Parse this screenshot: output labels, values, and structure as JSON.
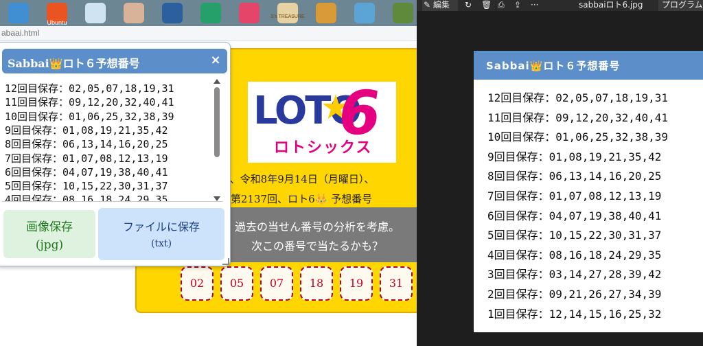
{
  "taskbar": {
    "icons": [
      {
        "name": "folder-icon",
        "label": "",
        "color": "#3f8fd2"
      },
      {
        "name": "ubuntu-icon",
        "label": "Ubuntu",
        "color": "#e95420"
      },
      {
        "name": "recycle-bin-icon",
        "label": "",
        "color": "#cfe3f2"
      },
      {
        "name": "profile-photo-icon",
        "label": "",
        "color": "#d8b39a"
      },
      {
        "name": "disc-icon",
        "label": "",
        "color": "#2c5f9e"
      },
      {
        "name": "download-folder-icon",
        "label": "",
        "color": "#25a06b"
      },
      {
        "name": "gift-icon",
        "label": "",
        "color": "#e6456a"
      },
      {
        "name": "treasure-icon",
        "label": "",
        "color": "#e6d2a2"
      },
      {
        "name": "dragon-icon",
        "label": "",
        "color": "#d99b38"
      },
      {
        "name": "notebook-icon",
        "label": "",
        "color": "#5aa5d6"
      },
      {
        "name": "landscape-icon",
        "label": "",
        "color": "#5f8a3c"
      }
    ],
    "treasure_text": "S's TREASURE"
  },
  "browser": {
    "url": "abaai.html"
  },
  "card": {
    "logo_text": "LOTO",
    "logo_digit": "6",
    "logo_katakana": "ロトシックス",
    "line1": "次回、令和8年9月14日（月曜日）、",
    "line2": "第2137回、ロト6👑 予想番号",
    "band_line1": "過去の当せん番号の分析を考慮。",
    "band_line2": "次この番号で当たるかも？",
    "numbers": [
      "02",
      "05",
      "07",
      "18",
      "19",
      "31"
    ]
  },
  "popup": {
    "title": "Sabbai👑ロト６予想番号",
    "close": "×",
    "rows": [
      "12回目保存：02,05,07,18,19,31",
      "11回目保存：09,12,20,32,40,41",
      "10回目保存：01,06,25,32,38,39",
      "9回目保存：01,08,19,21,35,42",
      "8回目保存：06,13,14,16,20,25",
      "7回目保存：01,07,08,12,13,19",
      "6回目保存：04,07,19,38,40,41",
      "5回目保存：10,15,22,30,31,37",
      "4回目保存：08,16,18,24,29,35"
    ],
    "btn_image_line1": "画像保存",
    "btn_image_line2": "(jpg)",
    "btn_file_line1": "ファイルに保存",
    "btn_file_line2": "(txt)"
  },
  "viewer": {
    "toolbar": {
      "edit": "編集",
      "rotate": "↻",
      "delete": "🗑",
      "print": "⎙",
      "share": "⇪",
      "more": "···",
      "filename": "sabbaiロト6.jpg",
      "program": "プログラムか"
    },
    "image": {
      "title": "Sabbai👑ロト６予想番号",
      "rows": [
        "12回目保存：02,05,07,18,19,31",
        "11回目保存：09,12,20,32,40,41",
        "10回目保存：01,06,25,32,38,39",
        "9回目保存：01,08,19,21,35,42",
        "8回目保存：06,13,14,16,20,25",
        "7回目保存：01,07,08,12,13,19",
        "6回目保存：04,07,19,38,40,41",
        "5回目保存：10,15,22,30,31,37",
        "4回目保存：08,16,18,24,29,35",
        "3回目保存：03,14,27,28,39,42",
        "2回目保存：09,21,26,27,34,39",
        "1回目保存：12,14,15,16,25,32"
      ]
    }
  }
}
